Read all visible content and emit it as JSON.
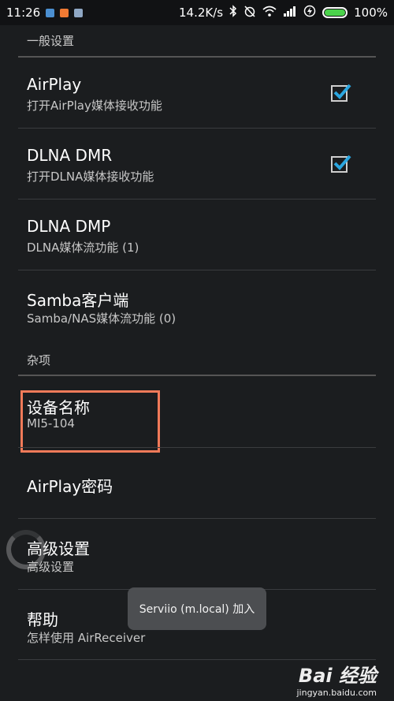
{
  "status_bar": {
    "time": "11:26",
    "speed": "14.2K/s",
    "battery": "100%",
    "battery_level": 1.0,
    "battery_color": "#4bd24b",
    "notification_icons": [
      "photo-icon",
      "app-icon",
      "message-icon"
    ],
    "system_icons": [
      "bluetooth-icon",
      "alarm-off-icon",
      "wifi-icon",
      "signal-icon",
      "charging-icon",
      "battery-icon"
    ]
  },
  "sections": {
    "general": "一般设置",
    "misc": "杂项"
  },
  "items": {
    "airplay": {
      "title": "AirPlay",
      "subtitle": "打开AirPlay媒体接收功能",
      "checked": true
    },
    "dlna_dmr": {
      "title": "DLNA DMR",
      "subtitle": "打开DLNA媒体接收功能",
      "checked": true
    },
    "dlna_dmp": {
      "title": "DLNA DMP",
      "subtitle": "DLNA媒体流功能 (1)"
    },
    "samba": {
      "title": "Samba客户端",
      "subtitle": "Samba/NAS媒体流功能 (0)"
    },
    "device_name": {
      "title": "设备名称",
      "subtitle": "MI5-104"
    },
    "airplay_password": {
      "title": "AirPlay密码"
    },
    "advanced": {
      "title": "高级设置",
      "subtitle": "高级设置"
    },
    "help": {
      "title": "帮助",
      "subtitle": "怎样使用 AirReceiver"
    }
  },
  "toast": {
    "text": "Serviio (m.local) 加入"
  },
  "watermark": {
    "logo": "Bai 经验",
    "url": "jingyan.baidu.com"
  },
  "colors": {
    "accent_check": "#2aa6e0",
    "highlight": "#f07a59"
  }
}
